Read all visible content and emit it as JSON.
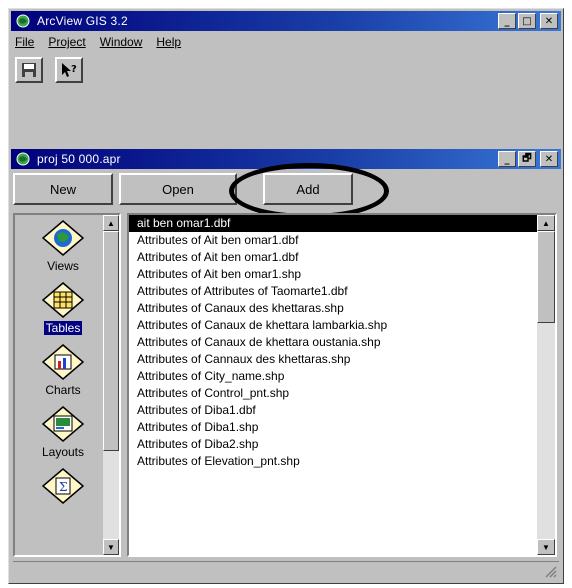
{
  "app": {
    "title": "ArcView GIS 3.2",
    "menus": [
      {
        "label": "File"
      },
      {
        "label": "Project"
      },
      {
        "label": "Window"
      },
      {
        "label": "Help"
      }
    ],
    "window_buttons": {
      "minimize": "_",
      "maximize": "□",
      "close": "✕"
    },
    "toolbar": [
      {
        "icon": "save-icon"
      },
      {
        "icon": "help-pointer-icon"
      }
    ]
  },
  "project_window": {
    "title": "proj 50 000.apr",
    "window_buttons": {
      "minimize": "_",
      "restore": "🗗",
      "close": "✕"
    },
    "buttons": {
      "new": "New",
      "open": "Open",
      "add": "Add"
    },
    "doc_types": [
      {
        "label": "Views",
        "icon": "views-globe-icon",
        "selected": false
      },
      {
        "label": "Tables",
        "icon": "tables-grid-icon",
        "selected": true
      },
      {
        "label": "Charts",
        "icon": "charts-bar-icon",
        "selected": false
      },
      {
        "label": "Layouts",
        "icon": "layouts-map-icon",
        "selected": false
      },
      {
        "label": "",
        "icon": "scripts-icon",
        "selected": false
      }
    ],
    "items": [
      "ait ben omar1.dbf",
      "Attributes of Ait ben omar1.dbf",
      "Attributes of Ait ben omar1.dbf",
      "Attributes of Ait ben omar1.shp",
      "Attributes of Attributes of Taomarte1.dbf",
      "Attributes of Canaux  des khettaras.shp",
      "Attributes of Canaux de khettara lambarkia.shp",
      "Attributes of Canaux de khettara oustania.shp",
      "Attributes of Cannaux des khettaras.shp",
      "Attributes of City_name.shp",
      "Attributes of Control_pnt.shp",
      "Attributes of Diba1.dbf",
      "Attributes of Diba1.shp",
      "Attributes of Diba2.shp",
      "Attributes of Elevation_pnt.shp"
    ],
    "selected_index": 0
  },
  "colors": {
    "titlebar_start": "#00007b",
    "titlebar_end": "#3a78d8",
    "face": "#c0c0c0",
    "selection": "#000080"
  }
}
